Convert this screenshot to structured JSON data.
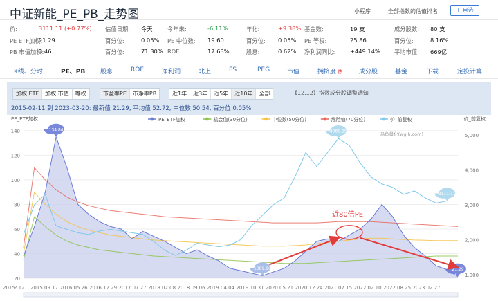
{
  "header": {
    "title": "中证新能_PE_PB_走势图",
    "mini_program": "小程序",
    "valuation_rank": "全部指数的估值排名",
    "add_button": "+ 自选"
  },
  "stats": [
    [
      {
        "label": "价:",
        "value": "3111.11 (+0.77%)",
        "tone": "red"
      },
      {
        "label": "估值日期:",
        "value": "今天"
      },
      {
        "label": "今年来:",
        "value": "-6.11%",
        "tone": "green"
      },
      {
        "label": "年化:",
        "value": "+9.38%",
        "tone": "red"
      },
      {
        "label": "基金数:",
        "value": "19 支"
      },
      {
        "label": "成分股数:",
        "value": "80 支"
      }
    ],
    [
      {
        "label": "PE ETF加权:",
        "value": "21.29"
      },
      {
        "label": "百分位:",
        "value": "0.05%"
      },
      {
        "label": "PE 中位数:",
        "value": "19.60"
      },
      {
        "label": "百分位:",
        "value": "0.05%"
      },
      {
        "label": "PE 等权:",
        "value": "25.86"
      },
      {
        "label": "百分位:",
        "value": "8.16%"
      }
    ],
    [
      {
        "label": "PB 市值加权:",
        "value": "3.46"
      },
      {
        "label": "百分位:",
        "value": "71.30%"
      },
      {
        "label": "ROE:",
        "value": "17.63%"
      },
      {
        "label": "股息:",
        "value": "0.62%"
      },
      {
        "label": "净利润同比:",
        "value": "+449.14%"
      },
      {
        "label": "平均市值:",
        "value": "669亿"
      }
    ]
  ],
  "tabs": [
    {
      "label": "K线、分时",
      "active": false
    },
    {
      "label": "PE、PB",
      "active": true
    },
    {
      "label": "股息",
      "active": false
    },
    {
      "label": "ROE",
      "active": false
    },
    {
      "label": "净利润",
      "active": false
    },
    {
      "label": "北上",
      "active": false
    },
    {
      "label": "PS",
      "active": false
    },
    {
      "label": "PEG",
      "active": false
    },
    {
      "label": "市值",
      "active": false
    },
    {
      "label": "拥挤度",
      "active": false,
      "badge": "热"
    },
    {
      "label": "成分股",
      "active": false
    },
    {
      "label": "基金",
      "active": false
    },
    {
      "label": "下载",
      "active": false
    },
    {
      "label": "定投计算",
      "active": false
    }
  ],
  "controls": {
    "weight_group": [
      "加权 ETF",
      "加权 市值",
      "等权"
    ],
    "weight_selected": 0,
    "ratio_group": [
      "市盈率PE",
      "市净率PB"
    ],
    "ratio_selected": 0,
    "period_group": [
      "近1年",
      "近3年",
      "近5年",
      "近10年",
      "全部"
    ],
    "period_selected": 3,
    "notice": "【12.12】指数成分股调整通知"
  },
  "summary": {
    "range": "2015-02-11 到 2023-03-20:",
    "latest": "最新值 21.29,",
    "average": "平均值 52.72,",
    "median": "中位数 50.54,",
    "percentile": "百分位 0.05%"
  },
  "chart_data": {
    "type": "line",
    "left_axis_title": "PE_ETF加权",
    "right_axis_title": "价_前复权",
    "watermark": "乌龟量化(wglh.com)",
    "left_ticks": [
      20,
      40,
      60,
      80,
      100,
      120,
      140
    ],
    "right_ticks": [
      1000,
      2000,
      3000,
      4000,
      5000
    ],
    "right_tick_labels": [
      "1,000",
      "2,000",
      "3,000",
      "4,000",
      "5,000"
    ],
    "ylim_left": [
      20,
      145
    ],
    "ylim_right": [
      900,
      5300
    ],
    "x_labels": [
      "2015",
      "2.12",
      "2015.09.17",
      "2016.05.26",
      "2016.12.29",
      "2017.07.27",
      "2018.02.08",
      "2018.09.06",
      "2019.04.04",
      "2019.10.31",
      "2020.05.21",
      "2020.12.24",
      "2021.07.15",
      "2022.02.10",
      "2022.08.25",
      "2023.02.27"
    ],
    "legend": [
      {
        "name": "PE_ETF加权",
        "color": "#6a7bd6"
      },
      {
        "name": "机会值(30分位)",
        "color": "#8bc34a"
      },
      {
        "name": "中位数(50分位)",
        "color": "#f5c242"
      },
      {
        "name": "危险值(70分位)",
        "color": "#e8665c"
      },
      {
        "name": "价_前复权",
        "color": "#7fc8e8"
      }
    ],
    "series": [
      {
        "name": "PE_ETF加权",
        "axis": "left",
        "values": [
          38,
          62,
          90,
          135,
          110,
          80,
          72,
          66,
          62,
          60,
          52,
          58,
          54,
          50,
          45,
          40,
          43,
          38,
          34,
          28,
          26,
          24,
          22,
          25,
          28,
          34,
          42,
          50,
          52,
          50,
          55,
          60,
          68,
          80,
          70,
          55,
          45,
          38,
          30,
          27,
          21.29
        ]
      },
      {
        "name": "机会值(30分位)",
        "axis": "left",
        "values": [
          35,
          70,
          62,
          55,
          50,
          47,
          45,
          43,
          42,
          41,
          40,
          39,
          38,
          37.5,
          37,
          36.5,
          36,
          35.5,
          35,
          34.5,
          34,
          33.5,
          33,
          32.5,
          32,
          32,
          32,
          32.5,
          33,
          33.5,
          34,
          34.5,
          35,
          35.5,
          36,
          36.5,
          37,
          37.5,
          38,
          38,
          38
        ]
      },
      {
        "name": "中位数(50分位)",
        "axis": "left",
        "values": [
          40,
          90,
          80,
          72,
          66,
          62,
          59,
          57,
          55,
          54,
          53,
          52,
          51,
          50.5,
          50,
          49.5,
          49,
          48.5,
          48,
          47.5,
          47,
          46.5,
          46,
          46,
          46,
          46.5,
          47,
          48,
          49,
          50,
          51,
          52,
          52.5,
          52.5,
          52,
          51.5,
          51,
          50.8,
          50.6,
          50.5,
          50.5
        ]
      },
      {
        "name": "危险值(70分位)",
        "axis": "left",
        "values": [
          45,
          110,
          100,
          92,
          86,
          82,
          79,
          77,
          75,
          74,
          73,
          72,
          71,
          70,
          69.5,
          69,
          68.5,
          68,
          67.5,
          67,
          66.5,
          66,
          65.5,
          65,
          65,
          65,
          65,
          65,
          65.5,
          66,
          66,
          66,
          66,
          65.5,
          65,
          64.5,
          64,
          63.5,
          63,
          62.5,
          62
        ]
      },
      {
        "name": "价_前复权",
        "axis": "right",
        "values": [
          2150,
          3000,
          3300,
          2400,
          2300,
          2200,
          2150,
          2250,
          2300,
          2250,
          2200,
          2150,
          1950,
          1700,
          1550,
          1700,
          1900,
          1850,
          1800,
          1850,
          2000,
          2400,
          2700,
          3000,
          3200,
          3800,
          4500,
          4100,
          4500,
          4900,
          4700,
          4200,
          3800,
          3600,
          3500,
          3300,
          3400,
          3200,
          3050,
          3111
        ]
      }
    ],
    "x_count": 41,
    "markers": [
      {
        "label": "134.84",
        "series": "PE_ETF加权",
        "index": 3,
        "color": "#6a7bd6"
      },
      {
        "label": "21.29",
        "series": "PE_ETF加权",
        "index": 40,
        "color": "#6a7bd6"
      },
      {
        "label": "1089.86",
        "series": "PE_ETF加权",
        "index": 22,
        "color": "#9fb6e6"
      },
      {
        "label": "4968.15",
        "series": "价_前复权",
        "index": 29,
        "color": "#a8d6ec"
      },
      {
        "label": "3111.11",
        "series": "价_前复权",
        "index": 39,
        "color": "#a8d6ec"
      }
    ],
    "annotation": {
      "text": "近80倍PE",
      "color": "#e23b3b"
    }
  }
}
